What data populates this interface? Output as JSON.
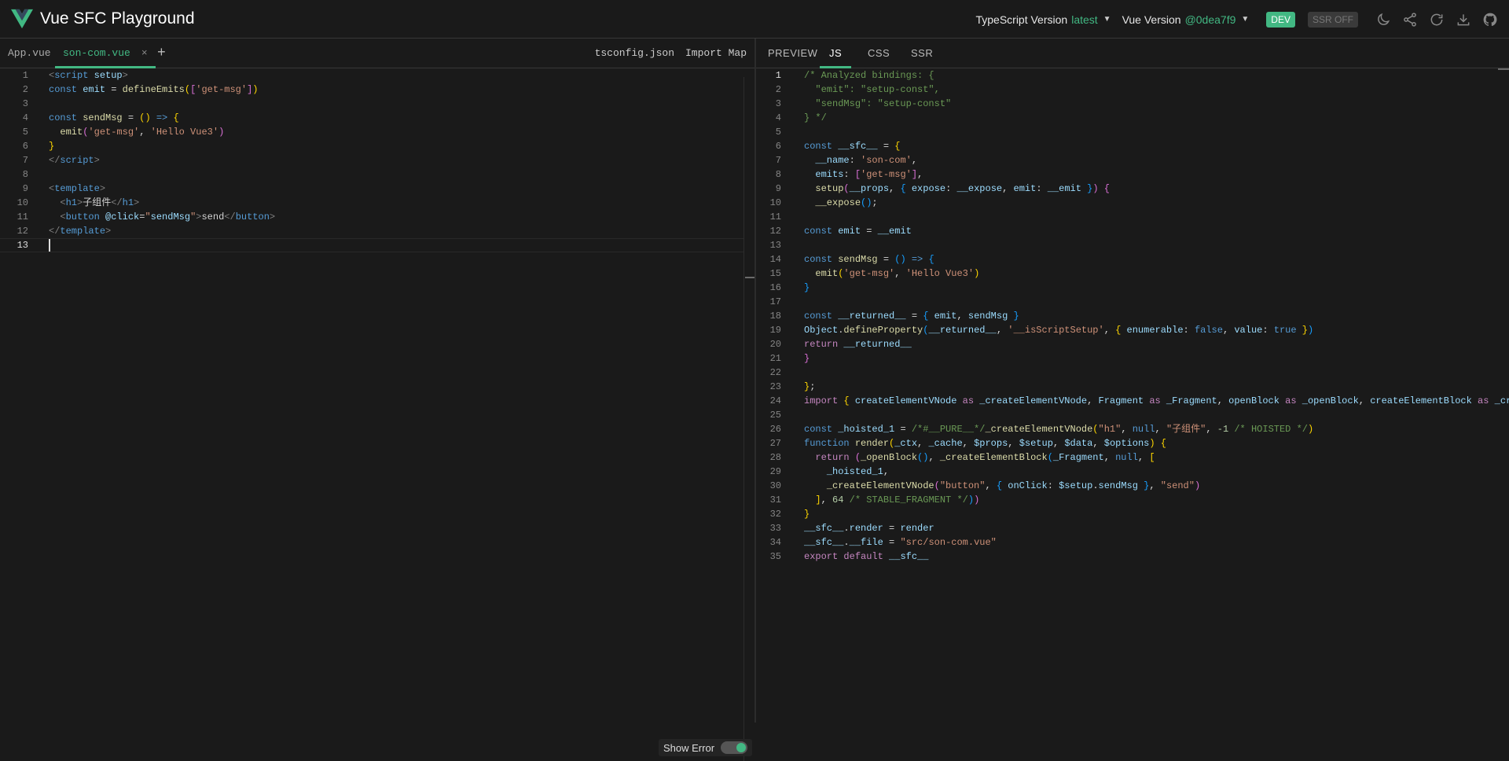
{
  "header": {
    "title": "Vue SFC Playground",
    "ts_label": "TypeScript Version",
    "ts_value": "latest",
    "vue_label": "Vue Version",
    "vue_value": "@0dea7f9",
    "dev_badge": "DEV",
    "ssr_badge": "SSR OFF",
    "icons": [
      "theme-moon-icon",
      "share-icon",
      "reload-icon",
      "download-icon",
      "github-icon"
    ]
  },
  "editor": {
    "tabs": [
      {
        "label": "App.vue",
        "active": false
      },
      {
        "label": "son-com.vue",
        "active": true,
        "close": "×"
      }
    ],
    "add_label": "+",
    "tsconfig_label": "tsconfig.json",
    "importmap_label": "Import Map",
    "lines": [
      "1",
      "2",
      "3",
      "4",
      "5",
      "6",
      "7",
      "8",
      "9",
      "10",
      "11",
      "12",
      "13"
    ]
  },
  "show_error": {
    "label": "Show Error",
    "on": true
  },
  "output": {
    "tabs": [
      "PREVIEW",
      "JS",
      "CSS",
      "SSR"
    ],
    "active_tab": "JS"
  },
  "colors": {
    "accent": "#42b883",
    "background": "#1a1a1a"
  }
}
